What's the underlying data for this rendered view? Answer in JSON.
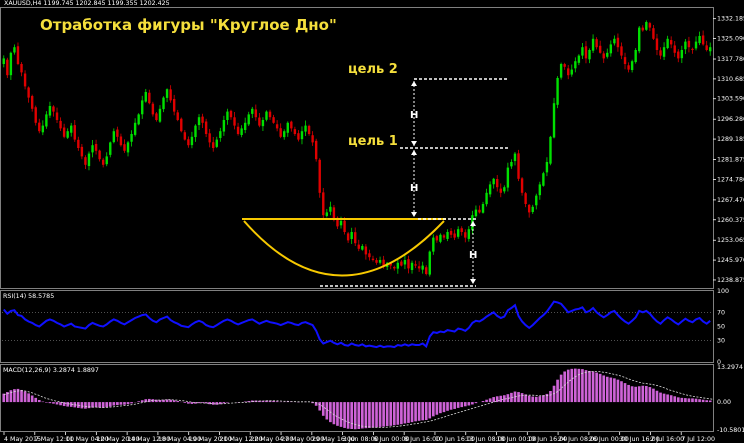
{
  "chart_data": [
    {
      "type": "candlestick",
      "symbol_header": "XAUUSD,H4  1199.745 1202.845 1199.355 1202.425",
      "title": "Отработка фигуры \"Круглое Дно\"",
      "ylim": [
        1236.0,
        1336.0
      ],
      "y_ticks": [
        "1332.185",
        "1325.090",
        "1317.780",
        "1310.685",
        "1303.590",
        "1296.280",
        "1289.185",
        "1281.875",
        "1274.780",
        "1267.470",
        "1260.375",
        "1253.065",
        "1245.970",
        "1238.875"
      ],
      "x_ticks": [
        "4 May 2015",
        "7 May 12:00",
        "11 May 04:00",
        "12 May 20:00",
        "14 May 12:00",
        "18 May 04:00",
        "19 May 20:00",
        "21 May 12:00",
        "22 May 04:00",
        "27 May 00:00",
        "29 May 16:00",
        "3 Jun 08:00",
        "6 Jun 00:00",
        "8 Jun 16:00",
        "10 Jun 16:00",
        "13 Jun 08:00",
        "18 Jun 00:00",
        "19 Jun 16:00",
        "24 Jun 08:00",
        "26 Jun 00:00",
        "30 Jun 16:00",
        "2 Jul 16:00",
        "7 Jul 12:00"
      ],
      "close": [
        1318,
        1312,
        1320,
        1322,
        1316,
        1313,
        1308,
        1304,
        1300,
        1295,
        1292,
        1294,
        1298,
        1301,
        1299,
        1296,
        1293,
        1290,
        1292,
        1294,
        1289,
        1286,
        1283,
        1280,
        1284,
        1287,
        1285,
        1282,
        1280,
        1283,
        1288,
        1292,
        1290,
        1287,
        1285,
        1288,
        1291,
        1295,
        1298,
        1303,
        1306,
        1302,
        1298,
        1296,
        1300,
        1304,
        1307,
        1303,
        1299,
        1296,
        1292,
        1289,
        1287,
        1290,
        1294,
        1297,
        1295,
        1291,
        1288,
        1286,
        1289,
        1292,
        1296,
        1299,
        1297,
        1294,
        1291,
        1293,
        1295,
        1298,
        1300,
        1297,
        1294,
        1296,
        1299,
        1297,
        1295,
        1293,
        1290,
        1292,
        1295,
        1293,
        1291,
        1289,
        1292,
        1294,
        1291,
        1288,
        1282,
        1270,
        1262,
        1263,
        1265,
        1261,
        1258,
        1260,
        1256,
        1253,
        1256,
        1252,
        1250,
        1251,
        1248,
        1247,
        1246,
        1245,
        1246,
        1244,
        1245,
        1244,
        1243,
        1245,
        1244,
        1246,
        1243,
        1245,
        1244,
        1243,
        1244,
        1241,
        1249,
        1254,
        1253,
        1255,
        1254,
        1256,
        1255,
        1254,
        1257,
        1256,
        1254,
        1257,
        1262,
        1264,
        1263,
        1266,
        1270,
        1273,
        1275,
        1272,
        1270,
        1272,
        1279,
        1281,
        1284,
        1275,
        1270,
        1266,
        1263,
        1265,
        1269,
        1273,
        1277,
        1281,
        1290,
        1302,
        1311,
        1316,
        1315,
        1312,
        1314,
        1317,
        1319,
        1322,
        1318,
        1321,
        1325,
        1322,
        1320,
        1318,
        1320,
        1323,
        1325,
        1322,
        1319,
        1316,
        1314,
        1317,
        1321,
        1329,
        1328,
        1331,
        1329,
        1325,
        1321,
        1319,
        1322,
        1325,
        1323,
        1320,
        1318,
        1321,
        1324,
        1322,
        1321,
        1324,
        1326,
        1323,
        1321,
        1322
      ],
      "range_label": "H",
      "levels": [
        {
          "label": "цель 1",
          "value": 1285.5
        },
        {
          "label": "цель 2",
          "value": 1308.0
        }
      ],
      "neckline": 1263.5,
      "bottom": 1239.5
    },
    {
      "type": "line",
      "header": "RSI(14) 58.5785",
      "ylim": [
        0,
        100
      ],
      "y_ticks": [
        "100",
        "70",
        "50",
        "30",
        "0"
      ],
      "color": "#0000ff",
      "values": [
        74,
        68,
        72,
        73,
        66,
        65,
        60,
        57,
        55,
        52,
        50,
        54,
        58,
        60,
        58,
        55,
        53,
        50,
        52,
        54,
        50,
        49,
        48,
        47,
        52,
        55,
        53,
        51,
        50,
        53,
        57,
        60,
        58,
        55,
        53,
        56,
        59,
        62,
        64,
        66,
        67,
        62,
        58,
        56,
        60,
        62,
        64,
        59,
        56,
        54,
        51,
        50,
        49,
        53,
        56,
        58,
        56,
        52,
        50,
        49,
        52,
        55,
        58,
        60,
        58,
        55,
        53,
        55,
        57,
        59,
        60,
        57,
        54,
        56,
        58,
        56,
        55,
        54,
        52,
        54,
        56,
        55,
        53,
        52,
        55,
        56,
        54,
        52,
        44,
        32,
        26,
        28,
        30,
        27,
        25,
        27,
        24,
        23,
        26,
        24,
        23,
        25,
        22,
        23,
        22,
        21,
        23,
        21,
        22,
        22,
        21,
        24,
        23,
        25,
        23,
        25,
        24,
        24,
        26,
        22,
        36,
        42,
        41,
        43,
        42,
        45,
        44,
        43,
        47,
        46,
        44,
        48,
        55,
        58,
        57,
        60,
        64,
        67,
        70,
        65,
        62,
        64,
        73,
        76,
        80,
        65,
        57,
        52,
        48,
        52,
        57,
        62,
        66,
        71,
        78,
        85,
        84,
        82,
        76,
        70,
        72,
        74,
        75,
        77,
        70,
        72,
        76,
        70,
        66,
        63,
        66,
        70,
        72,
        66,
        61,
        57,
        54,
        58,
        63,
        72,
        70,
        72,
        68,
        62,
        57,
        54,
        59,
        63,
        60,
        56,
        53,
        57,
        61,
        58,
        56,
        60,
        62,
        57,
        54,
        58
      ]
    },
    {
      "type": "bar",
      "header": "MACD(12,26,9) 3.2874 1.8897",
      "ylim": [
        -10.5801,
        13.2974
      ],
      "y_ticks": [
        "13.2974",
        "0.00",
        "-10.5801"
      ],
      "color": "#ce63d7",
      "values": [
        3.2,
        3.8,
        4.5,
        4.9,
        5.0,
        4.6,
        4.0,
        3.3,
        2.5,
        1.6,
        0.8,
        0.2,
        -0.2,
        -0.4,
        -0.6,
        -0.9,
        -1.2,
        -1.5,
        -1.7,
        -1.8,
        -2.0,
        -2.2,
        -2.4,
        -2.5,
        -2.3,
        -2.1,
        -2.0,
        -2.1,
        -2.2,
        -2.0,
        -1.7,
        -1.3,
        -1.1,
        -1.0,
        -1.0,
        -0.8,
        -0.5,
        -0.1,
        0.3,
        0.7,
        1.1,
        1.2,
        1.1,
        0.9,
        0.8,
        0.9,
        1.0,
        0.9,
        0.7,
        0.4,
        0.1,
        -0.3,
        -0.6,
        -0.7,
        -0.6,
        -0.4,
        -0.3,
        -0.5,
        -0.8,
        -1.0,
        -1.0,
        -0.8,
        -0.5,
        -0.2,
        0.0,
        0.0,
        -0.1,
        0.0,
        0.2,
        0.4,
        0.6,
        0.6,
        0.5,
        0.5,
        0.6,
        0.6,
        0.5,
        0.3,
        0.1,
        0.1,
        0.2,
        0.2,
        0.1,
        -0.1,
        0.0,
        0.1,
        0.0,
        -0.4,
        -1.4,
        -3.2,
        -5.2,
        -6.6,
        -7.6,
        -8.4,
        -9.0,
        -9.4,
        -9.8,
        -10.1,
        -10.2,
        -10.3,
        -10.2,
        -10.0,
        -9.9,
        -9.8,
        -9.7,
        -9.6,
        -9.4,
        -9.3,
        -9.1,
        -9.0,
        -8.8,
        -8.6,
        -8.4,
        -8.1,
        -7.9,
        -7.6,
        -7.3,
        -7.1,
        -6.9,
        -6.8,
        -6.2,
        -5.4,
        -4.8,
        -4.2,
        -3.8,
        -3.3,
        -2.9,
        -2.6,
        -2.2,
        -1.9,
        -1.6,
        -1.3,
        -0.9,
        -0.4,
        0.0,
        0.4,
        0.9,
        1.4,
        1.9,
        2.2,
        2.4,
        2.6,
        3.0,
        3.5,
        4.0,
        3.8,
        3.4,
        2.9,
        2.4,
        2.1,
        2.0,
        2.2,
        2.6,
        3.1,
        4.2,
        6.2,
        8.5,
        10.4,
        11.6,
        12.3,
        12.6,
        12.7,
        12.6,
        12.5,
        12.1,
        11.8,
        11.6,
        11.2,
        10.7,
        10.1,
        9.6,
        9.3,
        9.0,
        8.5,
        7.9,
        7.2,
        6.5,
        6.0,
        5.8,
        6.0,
        6.2,
        6.1,
        5.7,
        5.1,
        4.3,
        3.6,
        3.2,
        2.9,
        2.6,
        2.2,
        1.8,
        1.6,
        1.5,
        1.4,
        1.4,
        1.3,
        1.1,
        0.9,
        0.7,
        0.6
      ],
      "signal": [
        2.8,
        3.2,
        3.6,
        4.0,
        4.2,
        4.3,
        4.2,
        3.9,
        3.5,
        3.0,
        2.5,
        1.9,
        1.4,
        1.0,
        0.6,
        0.3,
        0.0,
        -0.3,
        -0.6,
        -0.8,
        -1.0,
        -1.3,
        -1.5,
        -1.7,
        -1.8,
        -1.9,
        -1.9,
        -2.0,
        -2.0,
        -2.0,
        -1.9,
        -1.8,
        -1.6,
        -1.5,
        -1.3,
        -1.2,
        -1.0,
        -0.8,
        -0.5,
        -0.2,
        0.1,
        0.4,
        0.6,
        0.7,
        0.8,
        0.8,
        0.9,
        0.9,
        0.8,
        0.7,
        0.6,
        0.4,
        0.2,
        0.0,
        -0.2,
        -0.3,
        -0.3,
        -0.4,
        -0.5,
        -0.6,
        -0.7,
        -0.7,
        -0.6,
        -0.5,
        -0.4,
        -0.3,
        -0.2,
        -0.2,
        -0.1,
        0.0,
        0.2,
        0.3,
        0.4,
        0.4,
        0.5,
        0.5,
        0.5,
        0.5,
        0.4,
        0.3,
        0.3,
        0.2,
        0.2,
        0.1,
        0.1,
        0.1,
        0.1,
        0.0,
        -0.3,
        -0.9,
        -1.8,
        -2.8,
        -3.8,
        -4.8,
        -5.6,
        -6.3,
        -7.0,
        -7.6,
        -8.1,
        -8.5,
        -8.8,
        -9.1,
        -9.3,
        -9.4,
        -9.5,
        -9.6,
        -9.6,
        -9.6,
        -9.5,
        -9.4,
        -9.3,
        -9.2,
        -9.0,
        -8.8,
        -8.6,
        -8.4,
        -8.2,
        -8.0,
        -7.7,
        -7.5,
        -7.2,
        -6.9,
        -6.5,
        -6.1,
        -5.7,
        -5.2,
        -4.8,
        -4.4,
        -4.0,
        -3.6,
        -3.2,
        -2.8,
        -2.4,
        -2.0,
        -1.6,
        -1.2,
        -0.8,
        -0.4,
        0.0,
        0.4,
        0.8,
        1.1,
        1.4,
        1.7,
        2.0,
        2.3,
        2.5,
        2.6,
        2.6,
        2.6,
        2.5,
        2.4,
        2.4,
        2.5,
        2.7,
        3.2,
        4.0,
        5.1,
        6.4,
        7.6,
        8.7,
        9.6,
        10.4,
        10.9,
        11.3,
        11.5,
        11.6,
        11.6,
        11.5,
        11.3,
        11.1,
        10.8,
        10.5,
        10.2,
        9.8,
        9.3,
        8.8,
        8.3,
        7.9,
        7.5,
        7.2,
        7.0,
        6.8,
        6.6,
        6.3,
        5.9,
        5.4,
        4.9,
        4.4,
        4.0,
        3.6,
        3.2,
        2.8,
        2.5,
        2.2,
        2.0,
        1.8,
        1.6,
        1.4,
        1.2,
        1.0
      ]
    }
  ]
}
